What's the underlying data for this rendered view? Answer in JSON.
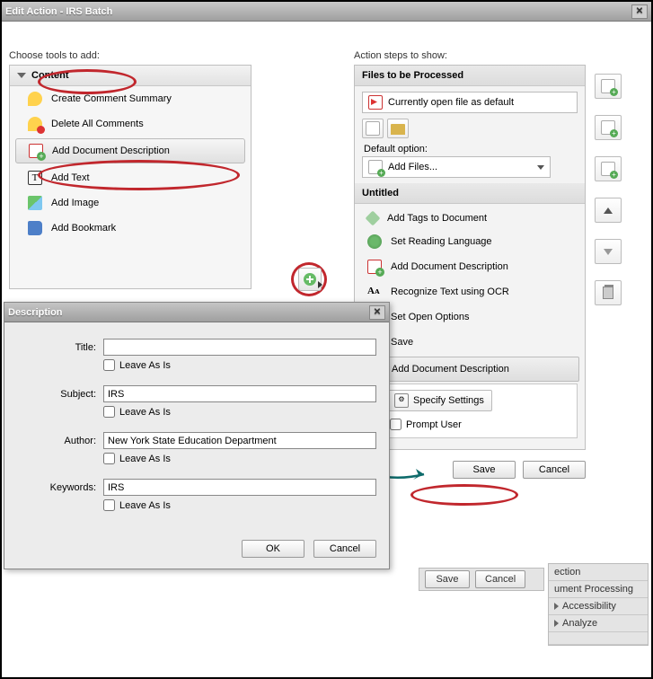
{
  "window": {
    "title": "Edit Action - IRS Batch"
  },
  "left": {
    "label": "Choose tools to add:",
    "content_header": "Content",
    "items": [
      {
        "label": "Create Comment Summary"
      },
      {
        "label": "Delete All Comments"
      },
      {
        "label": "Add Document Description"
      },
      {
        "label": "Add Text"
      },
      {
        "label": "Add Image"
      },
      {
        "label": "Add Bookmark"
      }
    ]
  },
  "right": {
    "label": "Action steps to show:",
    "files_header": "Files to be Processed",
    "current_file": "Currently open file as default",
    "default_option_label": "Default option:",
    "add_files": "Add Files...",
    "untitled_header": "Untitled",
    "steps": [
      {
        "label": "Add Tags to Document"
      },
      {
        "label": "Set Reading Language"
      },
      {
        "label": "Add Document Description"
      },
      {
        "label": "Recognize Text using OCR"
      },
      {
        "label": "Set Open Options"
      },
      {
        "label": "Save"
      },
      {
        "label": "Add Document Description"
      }
    ],
    "specify_settings": "Specify Settings",
    "prompt_user": "Prompt User",
    "save_btn": "Save",
    "cancel_btn": "Cancel"
  },
  "frag": {
    "save": "Save",
    "cancel": "Cancel",
    "rows": [
      "ection",
      "ument Processing",
      "Accessibility",
      "Analyze"
    ]
  },
  "desc": {
    "title": "Description",
    "fields": {
      "title_label": "Title:",
      "title_val": "",
      "subject_label": "Subject:",
      "subject_val": "IRS",
      "author_label": "Author:",
      "author_val": "New York State Education Department",
      "keywords_label": "Keywords:",
      "keywords_val": "IRS"
    },
    "leave": "Leave As Is",
    "ok": "OK",
    "cancel": "Cancel"
  }
}
